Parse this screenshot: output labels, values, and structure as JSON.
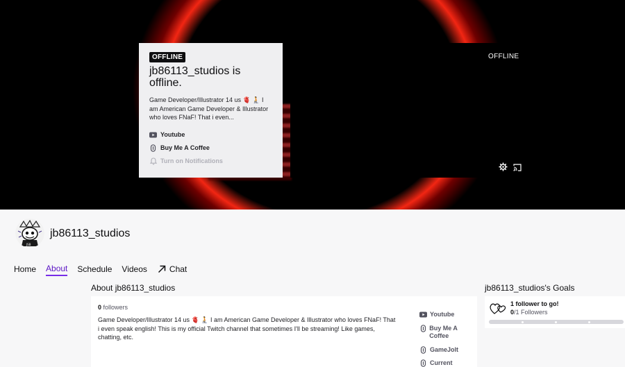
{
  "hero": {
    "badge": "OFFLINE",
    "title": "jb86113_studios is offline.",
    "description": "Game Developer/Illustrator 14 us 🫀 🧎 I am American Game Developer & Illustrator who loves FNaF! That i even...",
    "links": [
      {
        "label": "Youtube",
        "icon": "youtube-icon"
      },
      {
        "label": "Buy Me A Coffee",
        "icon": "link-icon"
      }
    ],
    "notifications_label": "Turn on Notifications",
    "player_status": "OFFLINE"
  },
  "channel": {
    "name": "jb86113_studios"
  },
  "nav": {
    "home": "Home",
    "about": "About",
    "schedule": "Schedule",
    "videos": "Videos",
    "chat": "Chat"
  },
  "about": {
    "heading": "About jb86113_studios",
    "followers_count": "0",
    "followers_label": "followers",
    "description": "Game Developer/Illustrator 14 us 🫀 🧎 I am American Game Developer & Illustrator who loves FNaF! That i even speak english! This is my official Twitch channel that sometimes I'll be streaming! Like games, chatting, etc.",
    "links": [
      {
        "label": "Youtube",
        "icon": "youtube-icon"
      },
      {
        "label": "Buy Me A Coffee",
        "icon": "link-icon"
      },
      {
        "label": "GameJolt",
        "icon": "link-icon"
      },
      {
        "label": "Current",
        "icon": "link-icon"
      }
    ]
  },
  "goals": {
    "heading": "jb86113_studios's Goals",
    "title": "1 follower to go!",
    "progress_current": "0",
    "progress_rest": "/1 Followers",
    "progress_fraction": 0
  },
  "colors": {
    "accent": "#772ce8",
    "accent_text": "#5c16c5"
  }
}
